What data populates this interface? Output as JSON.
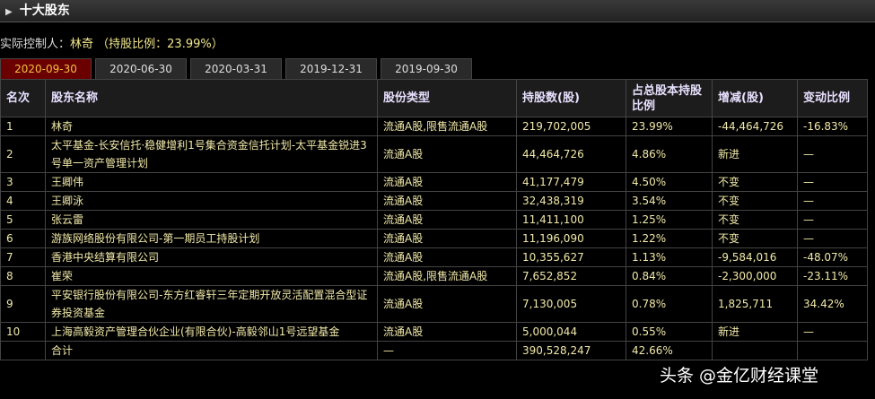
{
  "header": {
    "title": "十大股东"
  },
  "controller": {
    "label": "实际控制人：",
    "name": "林奇",
    "ratio": " （持股比例：23.99%）"
  },
  "tabs": [
    "2020-09-30",
    "2020-06-30",
    "2020-03-31",
    "2019-12-31",
    "2019-09-30"
  ],
  "columns": [
    "名次",
    "股东名称",
    "股份类型",
    "持股数(股)",
    "占总股本持股比例",
    "增减(股)",
    "变动比例"
  ],
  "rows": [
    [
      "1",
      "林奇",
      "流通A股,限售流通A股",
      "219,702,005",
      "23.99%",
      "-44,464,726",
      "-16.83%"
    ],
    [
      "2",
      "太平基金-长安信托·稳健增利1号集合资金信托计划-太平基金锐进3号单一资产管理计划",
      "流通A股",
      "44,464,726",
      "4.86%",
      "新进",
      "—"
    ],
    [
      "3",
      "王卿伟",
      "流通A股",
      "41,177,479",
      "4.50%",
      "不变",
      "—"
    ],
    [
      "4",
      "王卿泳",
      "流通A股",
      "32,438,319",
      "3.54%",
      "不变",
      "—"
    ],
    [
      "5",
      "张云雷",
      "流通A股",
      "11,411,100",
      "1.25%",
      "不变",
      "—"
    ],
    [
      "6",
      "游族网络股份有限公司-第一期员工持股计划",
      "流通A股",
      "11,196,090",
      "1.22%",
      "不变",
      "—"
    ],
    [
      "7",
      "香港中央结算有限公司",
      "流通A股",
      "10,355,627",
      "1.13%",
      "-9,584,016",
      "-48.07%"
    ],
    [
      "8",
      "崔荣",
      "流通A股,限售流通A股",
      "7,652,852",
      "0.84%",
      "-2,300,000",
      "-23.11%"
    ],
    [
      "9",
      "平安银行股份有限公司-东方红睿轩三年定期开放灵活配置混合型证券投资基金",
      "流通A股",
      "7,130,005",
      "0.78%",
      "1,825,711",
      "34.42%"
    ],
    [
      "10",
      "上海高毅资产管理合伙企业(有限合伙)-高毅邻山1号远望基金",
      "流通A股",
      "5,000,044",
      "0.55%",
      "新进",
      "—"
    ]
  ],
  "total": [
    "",
    "合计",
    "—",
    "390,528,247",
    "42.66%",
    "",
    ""
  ],
  "watermark": "头条 @金亿财经课堂"
}
